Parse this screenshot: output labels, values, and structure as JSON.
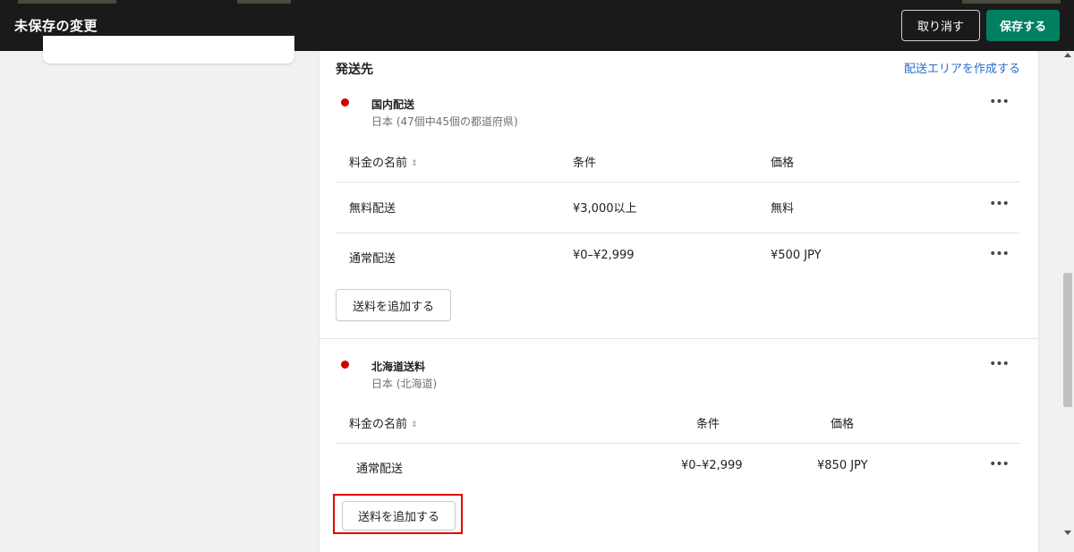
{
  "topbar": {
    "title": "未保存の変更",
    "discard_label": "取り消す",
    "save_label": "保存する"
  },
  "shipping": {
    "section_title": "発送先",
    "create_zone_link": "配送エリアを作成する",
    "zones": [
      {
        "name": "国内配送",
        "region": "日本 (47個中45個の都道府県)",
        "columns": {
          "rate_name": "料金の名前",
          "condition": "条件",
          "price": "価格"
        },
        "rates": [
          {
            "name": "無料配送",
            "condition": "¥3,000以上",
            "price": "無料"
          },
          {
            "name": "通常配送",
            "condition": "¥0–¥2,999",
            "price": "¥500 JPY"
          }
        ],
        "add_rate_label": "送料を追加する"
      },
      {
        "name": "北海道送料",
        "region": "日本 (北海道)",
        "columns": {
          "rate_name": "料金の名前",
          "condition": "条件",
          "price": "価格"
        },
        "rates": [
          {
            "name": "通常配送",
            "condition": "¥0–¥2,999",
            "price": "¥850 JPY"
          }
        ],
        "add_rate_label": "送料を追加する"
      }
    ]
  },
  "icons": {
    "more": "more-horizontal-icon",
    "sort": "sort-icon",
    "zone_marker": "zone-status-dot-icon"
  },
  "colors": {
    "topbar_bg": "#1a1a1a",
    "save_button": "#008060",
    "link": "#2c6ecb",
    "zone_dot": "#d10000",
    "highlight": "#e00000"
  }
}
